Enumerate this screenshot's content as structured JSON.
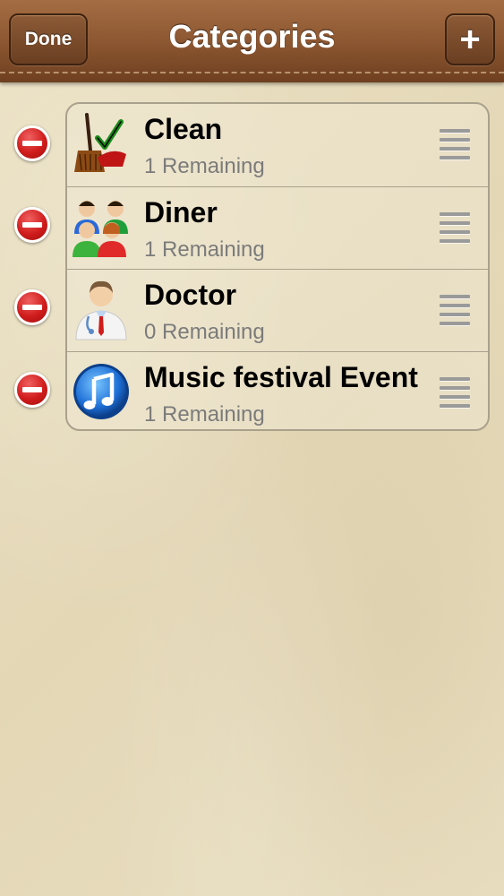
{
  "nav": {
    "title": "Categories",
    "done_label": "Done",
    "add_label": "+"
  },
  "categories": [
    {
      "name": "Clean",
      "remaining": "1 Remaining",
      "icon": "broom-check-icon"
    },
    {
      "name": "Diner",
      "remaining": "1 Remaining",
      "icon": "people-group-icon"
    },
    {
      "name": "Doctor",
      "remaining": "0 Remaining",
      "icon": "doctor-icon"
    },
    {
      "name": "Music festival Event",
      "remaining": "1 Remaining",
      "icon": "music-note-icon"
    }
  ],
  "colors": {
    "nav_leather": "#8a5530",
    "background": "#e7dcbd",
    "delete_red": "#d01c1c",
    "subtitle_gray": "#7b7b7b"
  }
}
